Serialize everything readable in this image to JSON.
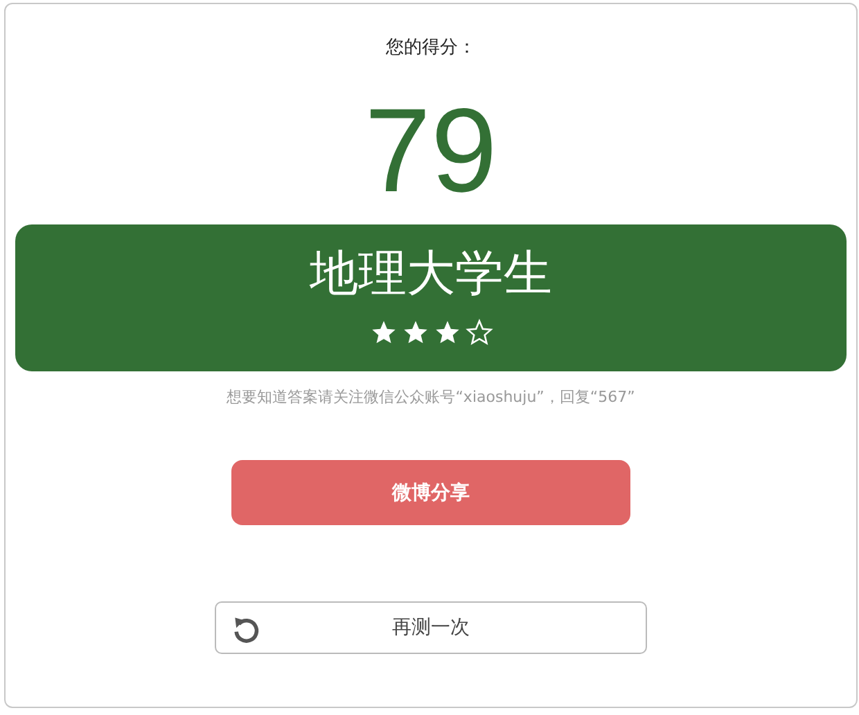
{
  "title": "您的得分：",
  "score": "79",
  "result": {
    "label": "地理大学生",
    "stars": 3
  },
  "hint": "想要知道答案请关注微信公众账号“xiaoshuju”，回复“567”",
  "share_button": "微博分享",
  "retry_button": "再测一次"
}
